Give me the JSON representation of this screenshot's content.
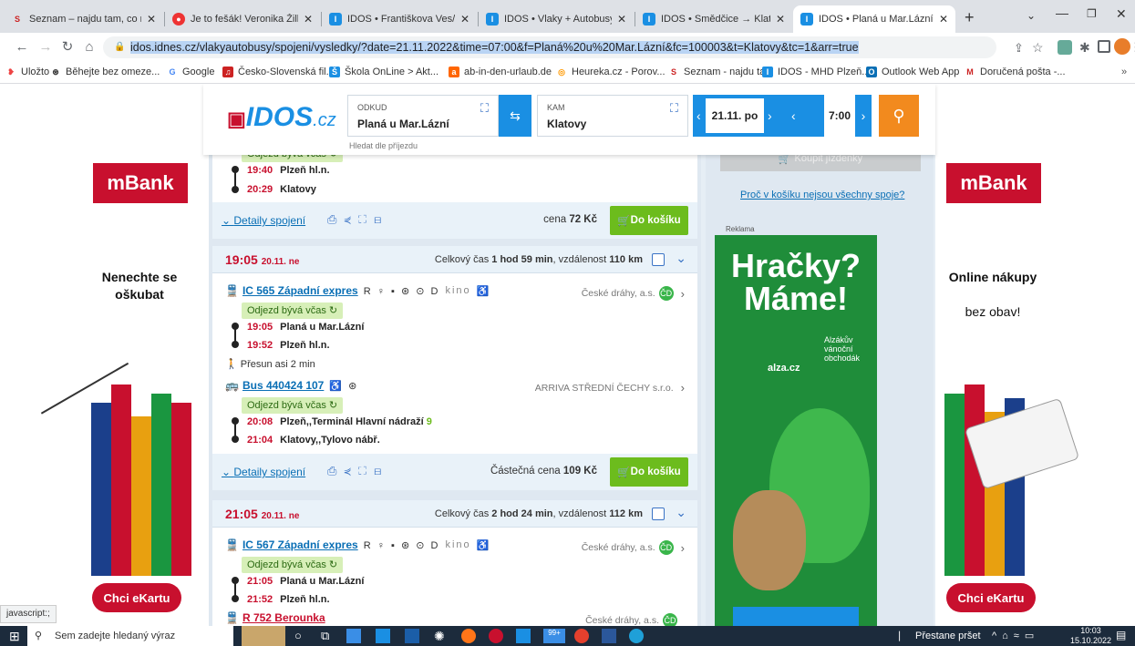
{
  "tabs": [
    {
      "label": "Seznam – najdu tam, co nezn",
      "icon": "S"
    },
    {
      "label": "Je to fešák! Veronika Žilková",
      "icon": "●"
    },
    {
      "label": "IDOS • Františkova Ves/Petro",
      "icon": "I"
    },
    {
      "label": "IDOS • Vlaky + Autobusy • Vy",
      "icon": "I"
    },
    {
      "label": "IDOS • Smědčice → Klatovy •",
      "icon": "I"
    },
    {
      "label": "IDOS • Planá u Mar.Lázní → K",
      "icon": "I"
    }
  ],
  "browser": {
    "url": "idos.idnes.cz/vlakyautobusy/spojeni/vysledky/?date=21.11.2022&time=07:00&f=Planá%20u%20Mar.Lázní&fc=100003&t=Klatovy&tc=1&arr=true",
    "status": "javascript:;"
  },
  "bookmarks": [
    {
      "label": "Uložto",
      "color": "#e44"
    },
    {
      "label": "Běhejte bez omeze...",
      "color": "#333"
    },
    {
      "label": "Google",
      "color": "#4285f4"
    },
    {
      "label": "Česko-Slovenská fil...",
      "color": "#c22"
    },
    {
      "label": "Škola OnLine > Akt...",
      "color": "#1a8fe3"
    },
    {
      "label": "ab-in-den-urlaub.de",
      "color": "#f60"
    },
    {
      "label": "Heureka.cz - Porov...",
      "color": "#f90"
    },
    {
      "label": "Seznam - najdu ta...",
      "color": "#c22"
    },
    {
      "label": "IDOS - MHD Plzeň...",
      "color": "#1a8fe3"
    },
    {
      "label": "Outlook Web App",
      "color": "#0a6fb5"
    },
    {
      "label": "Doručená pošta -...",
      "color": "#c22"
    }
  ],
  "search": {
    "logo": "IDOS",
    "logo_suffix": ".cz",
    "from_label": "ODKUD",
    "from_value": "Planá u Mar.Lázní",
    "to_label": "KAM",
    "to_value": "Klatovy",
    "arrival_hint": "Hledat dle příjezdu",
    "date": "21.11. po",
    "time": "7:00"
  },
  "connections": [
    {
      "stops_tail": [
        {
          "time": "19:40",
          "name": "Plzeň hl.n."
        },
        {
          "time": "20:29",
          "name": "Klatovy"
        }
      ],
      "ontime": "Odjezd bývá včas",
      "detail": "Detaily spojení",
      "price_label": "cena",
      "price": "72 Kč",
      "cart": "Do košíku"
    },
    {
      "dep": "19:05",
      "date": "20.11. ne",
      "summary_prefix": "Celkový čas",
      "duration": "1 hod 59 min",
      "distance_prefix": ", vzdálenost",
      "distance": "110 km",
      "legs": [
        {
          "train": "IC 565 Západní expres",
          "icons": "R ♀ ▪ ⊛ ⊙ D",
          "extra": "kino",
          "carrier": "České dráhy, a.s.",
          "ontime": "Odjezd bývá včas",
          "stops": [
            {
              "time": "19:05",
              "name": "Planá u Mar.Lázní"
            },
            {
              "time": "19:52",
              "name": "Plzeň hl.n."
            }
          ]
        },
        {
          "transfer": "Přesun asi 2 min",
          "train": "Bus 440424 107",
          "icons": "♿ ⊛",
          "carrier": "ARRIVA STŘEDNÍ ČECHY s.r.o.",
          "ontime": "Odjezd bývá včas",
          "stops": [
            {
              "time": "20:08",
              "name": "Plzeň,,Terminál Hlavní nádraží",
              "platform": "9"
            },
            {
              "time": "21:04",
              "name": "Klatovy,,Tylovo nábř."
            }
          ]
        }
      ],
      "detail": "Detaily spojení",
      "price_label": "Částečná cena",
      "price": "109 Kč",
      "cart": "Do košíku"
    },
    {
      "dep": "21:05",
      "date": "20.11. ne",
      "summary_prefix": "Celkový čas",
      "duration": "2 hod 24 min",
      "distance_prefix": ", vzdálenost",
      "distance": "112 km",
      "train": "IC 567 Západní expres",
      "icons": "R ♀ ▪ ⊛ ⊙ D",
      "extra": "kino",
      "carrier": "České dráhy, a.s.",
      "ontime": "Odjezd bývá včas",
      "stops": [
        {
          "time": "21:05",
          "name": "Planá u Mar.Lázní"
        },
        {
          "time": "21:52",
          "name": "Plzeň hl.n."
        }
      ],
      "next_train": "R 752 Berounka",
      "next_carrier": "České dráhy, a.s."
    }
  ],
  "sidebar": {
    "buy": "Koupit jízdenky",
    "why_link": "Proč v košíku nejsou všechny spoje?",
    "ad_label": "Reklama",
    "ad_headline_1": "Hračky?",
    "ad_headline_2": "Máme!",
    "ad_brand": "alza.cz",
    "ad_sub": "Alzákův vánoční obchodák"
  },
  "side_ads": {
    "left_brand": "mBank",
    "left_text": "Nenechte se oškubat",
    "left_cta": "Chci eKartu",
    "right_brand": "mBank",
    "right_text_1": "Online nákupy",
    "right_text_2": "bez obav!",
    "right_cta": "Chci eKartu"
  },
  "taskbar": {
    "search": "Sem zadejte hledaný výraz",
    "weather": "Přestane pršet",
    "time": "10:03",
    "date": "15.10.2022",
    "badge": "99+"
  }
}
